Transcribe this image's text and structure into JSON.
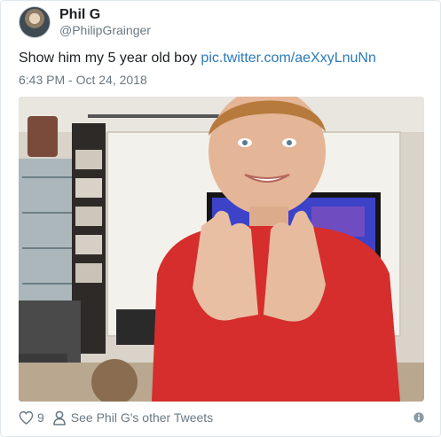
{
  "author": {
    "display_name": "Phil G",
    "handle": "@PhilipGrainger"
  },
  "tweet": {
    "text": "Show him my 5 year old boy ",
    "link": "pic.twitter.com/aeXxyLnuNn",
    "timestamp": "6:43 PM - Oct 24, 2018"
  },
  "footer": {
    "like_count": "9",
    "other_tweets_label": "See Phil G's other Tweets"
  },
  "icons": {
    "like": "heart-outline-icon",
    "profile": "person-outline-icon",
    "info": "info-circle-icon"
  },
  "colors": {
    "link": "#2b7bb9",
    "secondary_text": "#697882",
    "primary_text": "#1c2022",
    "border": "#e1e8ed"
  }
}
